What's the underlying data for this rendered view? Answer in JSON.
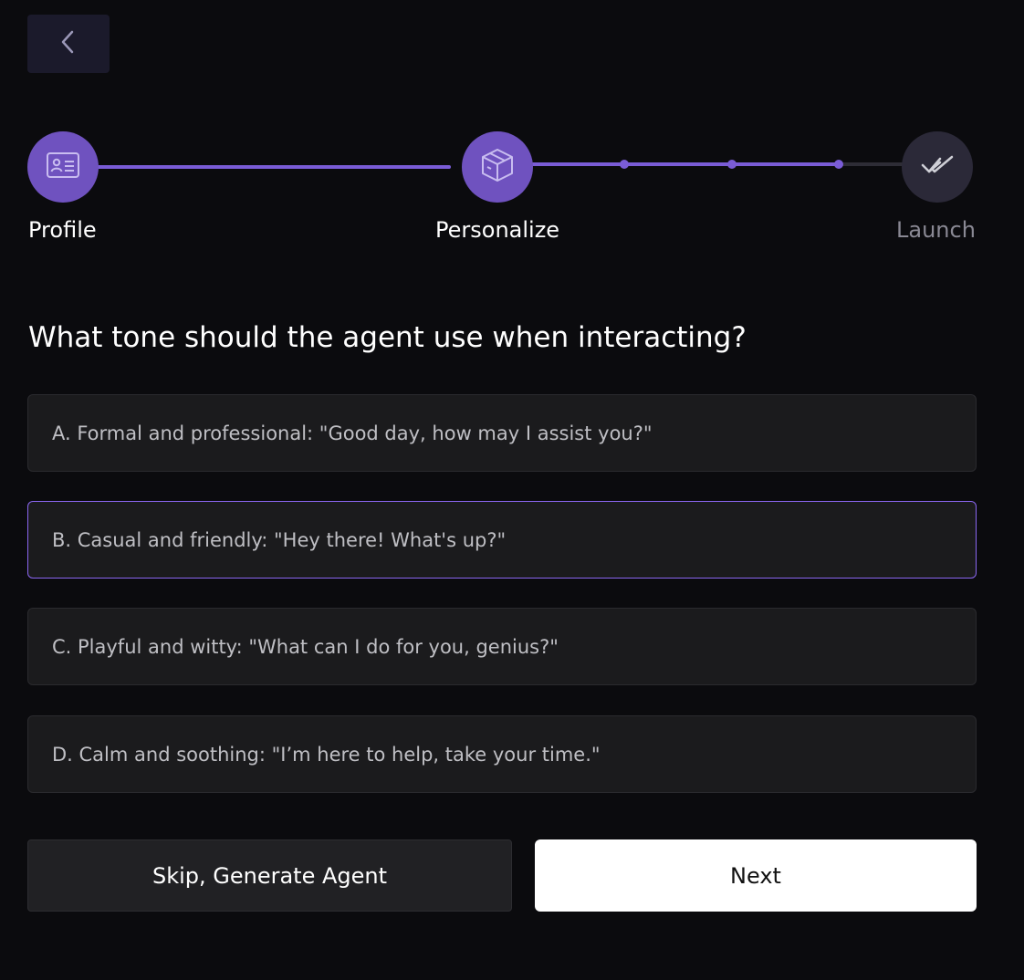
{
  "back_button": {
    "icon": "chevron-left-icon"
  },
  "stepper": {
    "steps": [
      {
        "label": "Profile",
        "icon": "id-card-icon",
        "state": "completed"
      },
      {
        "label": "Personalize",
        "icon": "box-icon",
        "state": "current"
      },
      {
        "label": "Launch",
        "icon": "double-check-icon",
        "state": "upcoming"
      }
    ],
    "colors": {
      "active": "#6f52bf",
      "inactive": "#2b2938",
      "line_active": "#7a5cd6",
      "line_inactive": "#2e2d36"
    }
  },
  "question": "What tone should the agent use when interacting?",
  "options": [
    {
      "text": "A. Formal and professional: \"Good day, how may I assist you?\"",
      "selected": false
    },
    {
      "text": "B. Casual and friendly: \"Hey there! What's up?\"",
      "selected": true
    },
    {
      "text": "C. Playful and witty: \"What can I do for you, genius?\"",
      "selected": false
    },
    {
      "text": "D. Calm and soothing: \"I’m here to help, take your time.\"",
      "selected": false
    }
  ],
  "actions": {
    "skip_label": "Skip, Generate Agent",
    "next_label": "Next"
  }
}
